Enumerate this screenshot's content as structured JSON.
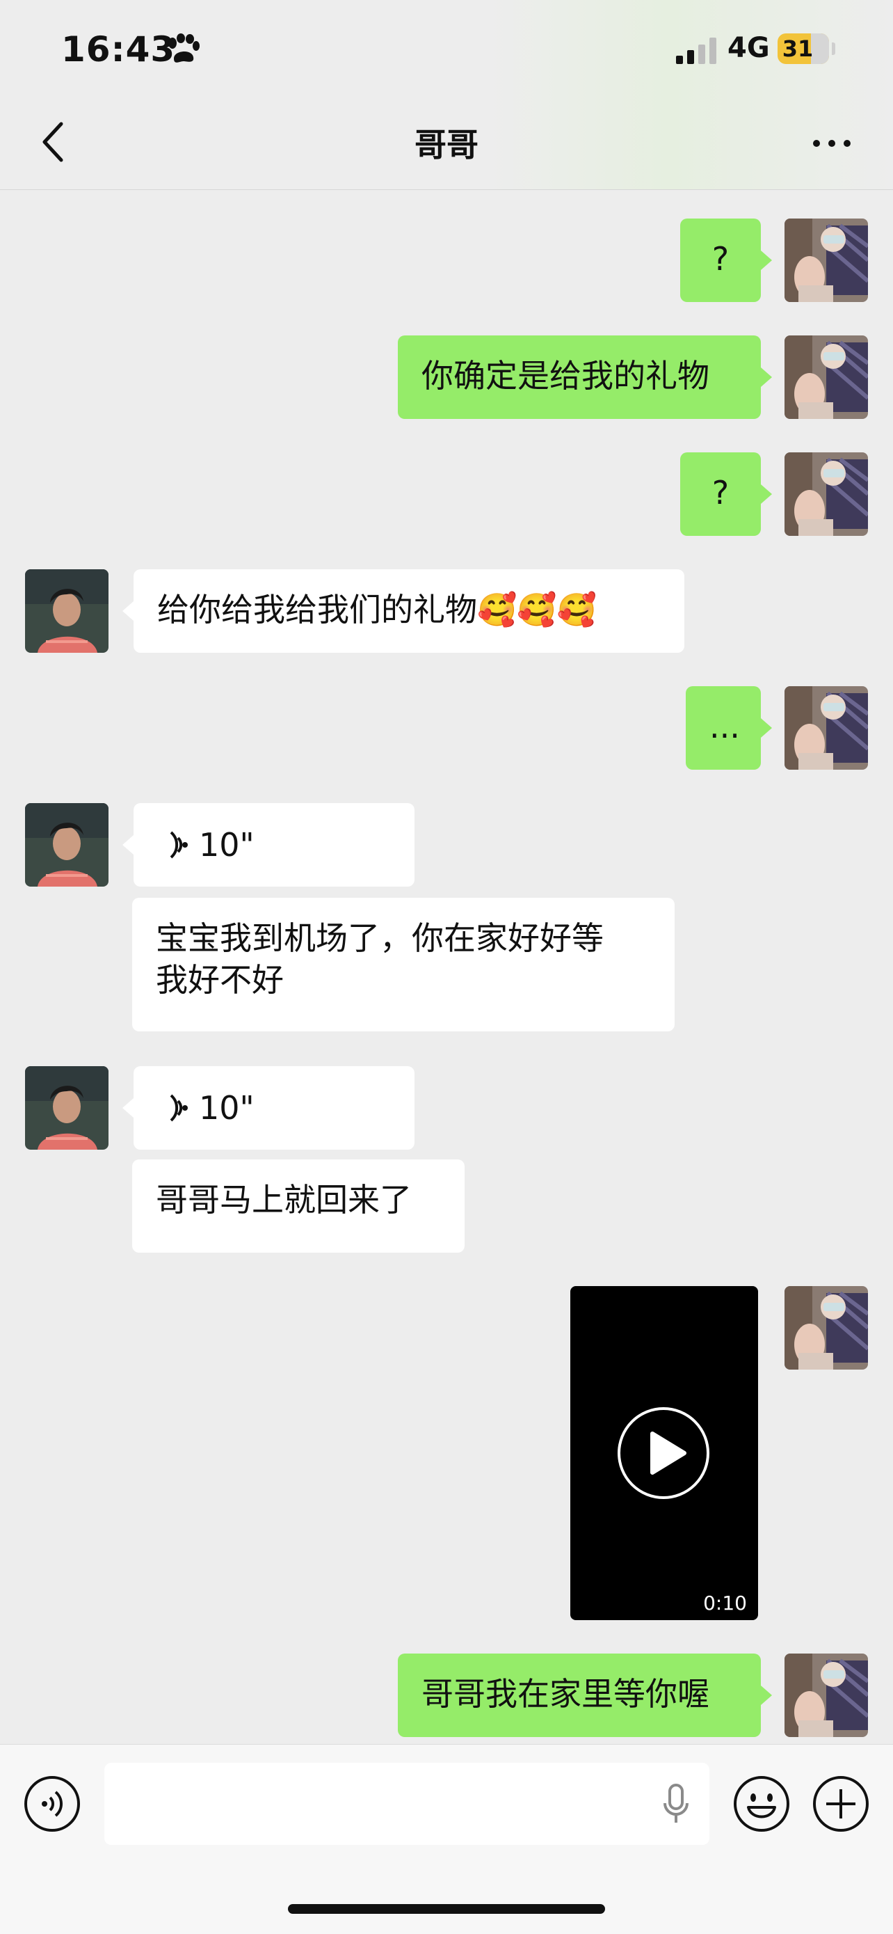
{
  "status_bar": {
    "time": "16:43",
    "network": "4G",
    "battery": "31"
  },
  "nav": {
    "title": "哥哥"
  },
  "messages": [
    {
      "side": "me",
      "text": "?"
    },
    {
      "side": "me",
      "text": "你确定是给我的礼物"
    },
    {
      "side": "me",
      "text": "?"
    },
    {
      "side": "them",
      "text": "给你给我给我们的礼物",
      "emoji": "🥰🥰🥰"
    },
    {
      "side": "me",
      "text": "..."
    },
    {
      "side": "them",
      "type": "voice",
      "duration": "10\""
    },
    {
      "side": "them",
      "text_line1": "宝宝我到机场了，你在家好好等",
      "text_line2": "我好不好"
    },
    {
      "side": "them",
      "type": "voice",
      "duration": "10\""
    },
    {
      "side": "them",
      "text": "哥哥马上就回来了"
    },
    {
      "side": "me",
      "type": "video",
      "duration": "0:10"
    },
    {
      "side": "me",
      "text": "哥哥我在家里等你喔"
    }
  ],
  "icons": {
    "back": "chevron-left-icon",
    "more": "more-dots-icon",
    "voice_toggle": "voice-icon",
    "mic": "microphone-icon",
    "emoji": "emoji-icon",
    "plus": "plus-icon",
    "play": "play-icon"
  },
  "colors": {
    "my_bubble": "#95ec69",
    "their_bubble": "#ffffff",
    "background": "#ededed"
  }
}
